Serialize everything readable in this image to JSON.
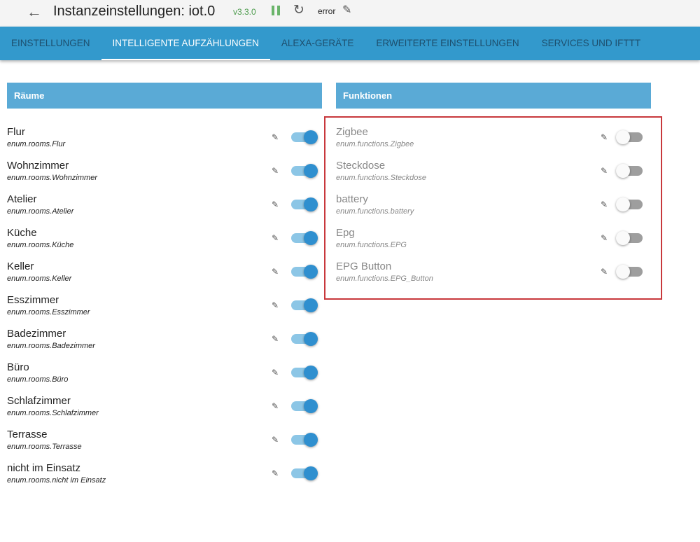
{
  "header": {
    "title": "Instanzeinstellungen: iot.0",
    "version": "v3.3.0",
    "status": "error"
  },
  "tabs": [
    "EINSTELLUNGEN",
    "INTELLIGENTE AUFZÄHLUNGEN",
    "ALEXA-GERÄTE",
    "ERWEITERTE EINSTELLUNGEN",
    "SERVICES UND IFTTT"
  ],
  "rooms": {
    "title": "Räume",
    "items": [
      {
        "name": "Flur",
        "id": "enum.rooms.Flur",
        "enabled": true
      },
      {
        "name": "Wohnzimmer",
        "id": "enum.rooms.Wohnzimmer",
        "enabled": true
      },
      {
        "name": "Atelier",
        "id": "enum.rooms.Atelier",
        "enabled": true
      },
      {
        "name": "Küche",
        "id": "enum.rooms.Küche",
        "enabled": true
      },
      {
        "name": "Keller",
        "id": "enum.rooms.Keller",
        "enabled": true
      },
      {
        "name": "Esszimmer",
        "id": "enum.rooms.Esszimmer",
        "enabled": true
      },
      {
        "name": "Badezimmer",
        "id": "enum.rooms.Badezimmer",
        "enabled": true
      },
      {
        "name": "Büro",
        "id": "enum.rooms.Büro",
        "enabled": true
      },
      {
        "name": "Schlafzimmer",
        "id": "enum.rooms.Schlafzimmer",
        "enabled": true
      },
      {
        "name": "Terrasse",
        "id": "enum.rooms.Terrasse",
        "enabled": true
      },
      {
        "name": "nicht im Einsatz",
        "id": "enum.rooms.nicht im Einsatz",
        "enabled": true
      }
    ]
  },
  "functions": {
    "title": "Funktionen",
    "items": [
      {
        "name": "Zigbee",
        "id": "enum.functions.Zigbee",
        "enabled": false
      },
      {
        "name": "Steckdose",
        "id": "enum.functions.Steckdose",
        "enabled": false
      },
      {
        "name": "battery",
        "id": "enum.functions.battery",
        "enabled": false
      },
      {
        "name": "Epg",
        "id": "enum.functions.EPG",
        "enabled": false
      },
      {
        "name": "EPG Button",
        "id": "enum.functions.EPG_Button",
        "enabled": false
      }
    ]
  }
}
